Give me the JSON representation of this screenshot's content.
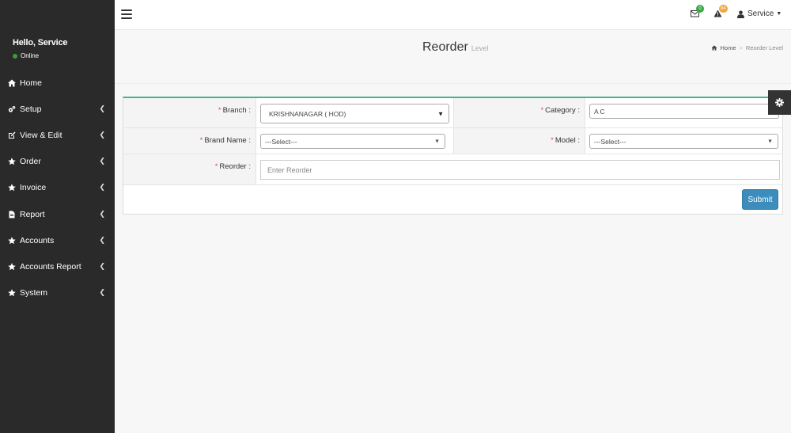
{
  "sidebar": {
    "greeting": "Hello, Service",
    "status": "Online",
    "items": [
      {
        "label": "Home",
        "icon": "home-icon",
        "has_children": false
      },
      {
        "label": "Setup",
        "icon": "cogs-icon",
        "has_children": true
      },
      {
        "label": "View & Edit",
        "icon": "edit-icon",
        "has_children": true
      },
      {
        "label": "Order",
        "icon": "star-icon",
        "has_children": true
      },
      {
        "label": "Invoice",
        "icon": "star-icon",
        "has_children": true
      },
      {
        "label": "Report",
        "icon": "file-icon",
        "has_children": true
      },
      {
        "label": "Accounts",
        "icon": "star-icon",
        "has_children": true
      },
      {
        "label": "Accounts Report",
        "icon": "star-icon",
        "has_children": true
      },
      {
        "label": "System",
        "icon": "star-icon",
        "has_children": true
      }
    ]
  },
  "topbar": {
    "mail_count": "0",
    "alert_count": "84",
    "user_name": "Service"
  },
  "header": {
    "title": "Reorder",
    "subtitle": "Level",
    "breadcrumb": {
      "home": "Home",
      "current": "Reorder Level"
    }
  },
  "form": {
    "branch_label": "Branch :",
    "branch_value": "KRISHNANAGAR ( HOD)",
    "category_label": "Category :",
    "category_value": "A C",
    "brand_label": "Brand Name :",
    "brand_value": "---Select---",
    "model_label": "Model :",
    "model_value": "---Select---",
    "reorder_label": "Reorder :",
    "reorder_placeholder": "Enter Reorder",
    "required_mark": "*",
    "submit_label": "Submit"
  },
  "colors": {
    "sidebar_bg": "#2a2a2a",
    "accent_green": "#48b290",
    "button_blue": "#3c8dbc",
    "online_green": "#3c9b3c"
  }
}
